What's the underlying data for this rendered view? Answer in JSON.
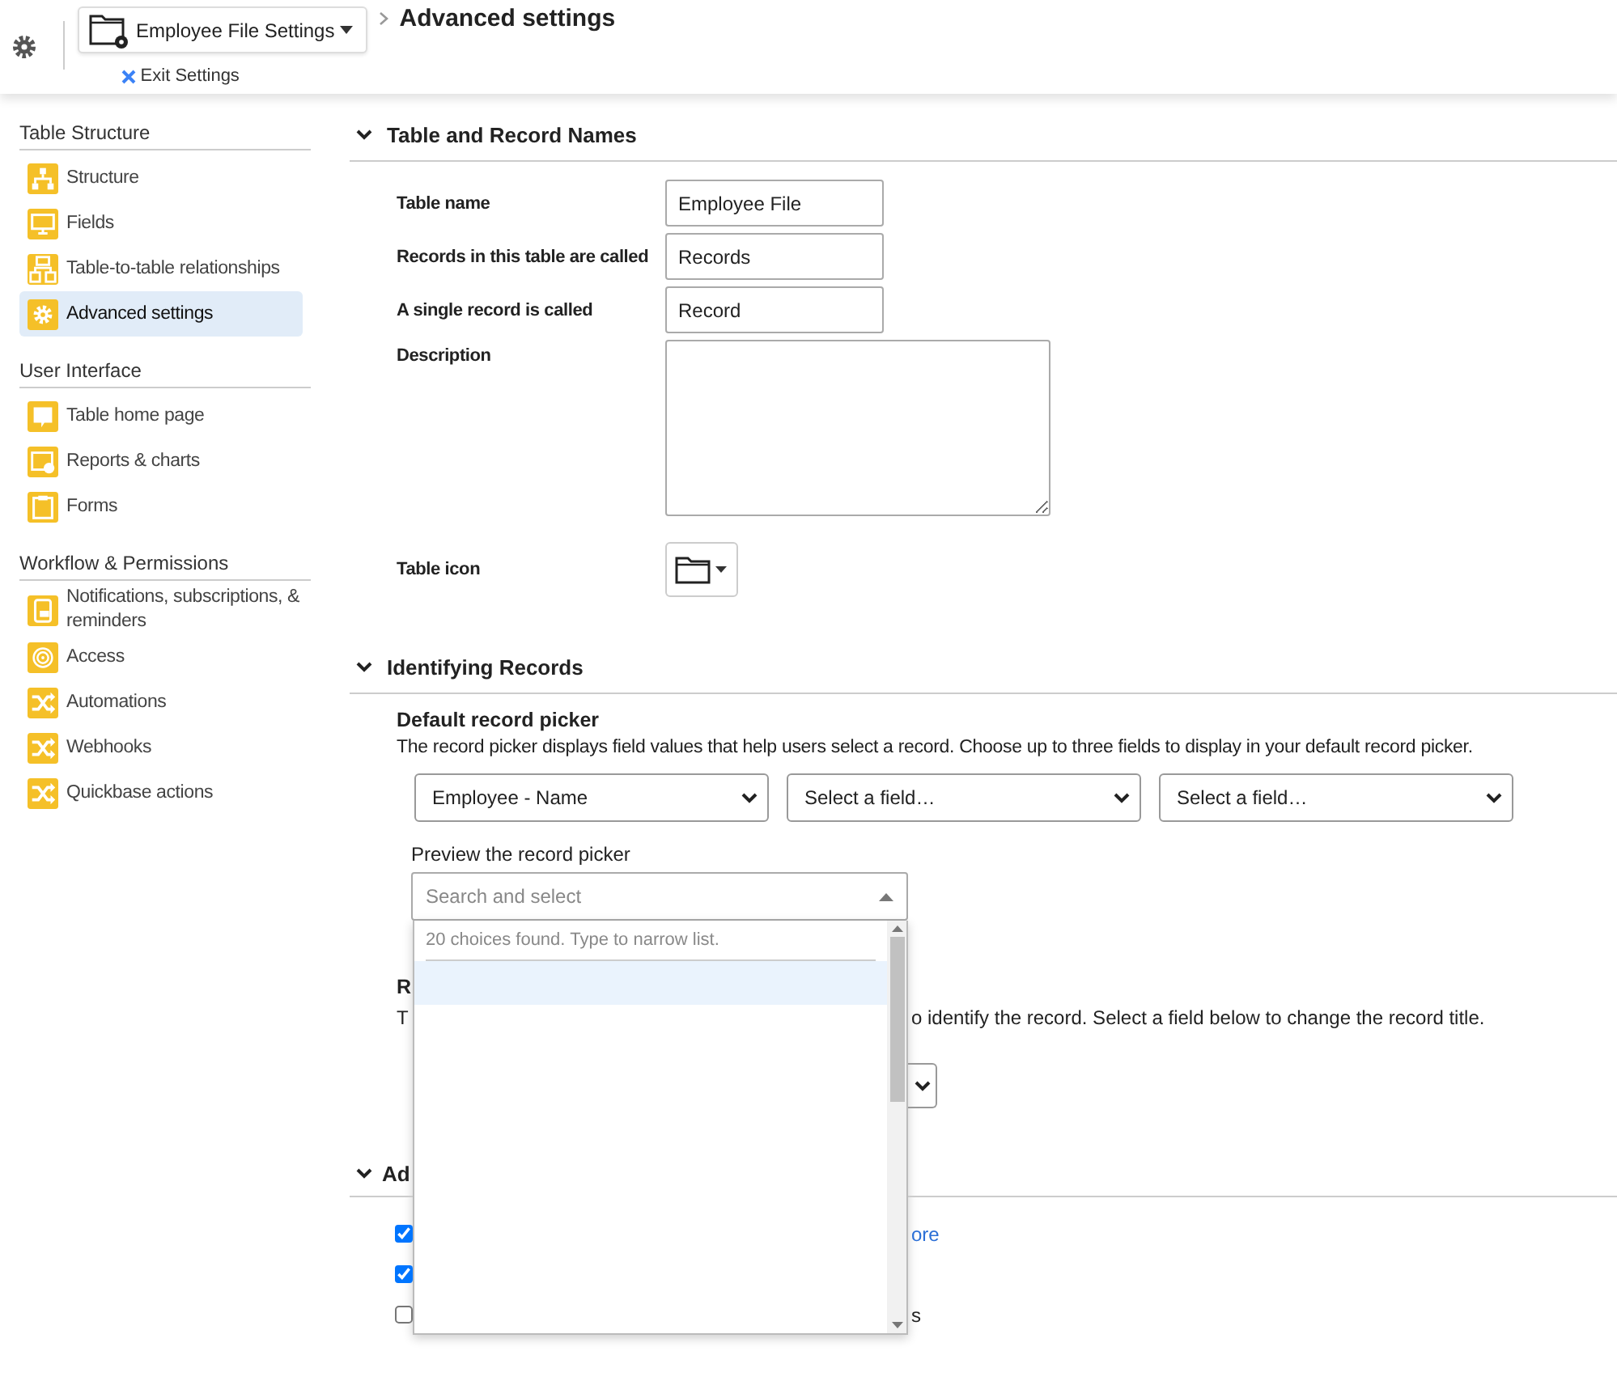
{
  "header": {
    "app_menu": "Employee File Settings",
    "exit": "Exit Settings",
    "page_title": "Advanced settings"
  },
  "sidebar": [
    {
      "title": "Table Structure",
      "items": [
        {
          "label": "Structure",
          "selected": false
        },
        {
          "label": "Fields",
          "selected": false
        },
        {
          "label": "Table-to-table relationships",
          "selected": false
        },
        {
          "label": "Advanced settings",
          "selected": true
        }
      ]
    },
    {
      "title": "User Interface",
      "items": [
        {
          "label": "Table home page",
          "selected": false
        },
        {
          "label": "Reports & charts",
          "selected": false
        },
        {
          "label": "Forms",
          "selected": false
        }
      ]
    },
    {
      "title": "Workflow & Permissions",
      "items": [
        {
          "label": "Notifications, subscriptions, & reminders",
          "selected": false
        },
        {
          "label": "Access",
          "selected": false
        },
        {
          "label": "Automations",
          "selected": false
        },
        {
          "label": "Webhooks",
          "selected": false
        },
        {
          "label": "Quickbase actions",
          "selected": false
        }
      ]
    }
  ],
  "names_section": {
    "title": "Table and Record Names",
    "fields": [
      {
        "label": "Table name",
        "value": "Employee File"
      },
      {
        "label": "Records in this table are called",
        "value": "Records"
      },
      {
        "label": "A single record is called",
        "value": "Record"
      }
    ],
    "description_label": "Description",
    "icon_label": "Table icon"
  },
  "identifying_section": {
    "title": "Identifying Records",
    "picker_heading": "Default record picker",
    "picker_description": "The record picker displays field values that help users select a record. Choose up to three fields to display in your default record picker.",
    "selects": [
      "Employee - Name",
      "Select a field…",
      "Select a field…"
    ],
    "preview_label": "Preview the record picker",
    "preview_placeholder": "Search and select",
    "dropdown_hint": "20 choices found. Type to narrow list.",
    "title_heading": "R",
    "title_description_start": "T",
    "title_description_end": "o identify the record. Select a field below to change the record title."
  },
  "advanced_section": {
    "title": "Ad",
    "options": [
      {
        "checked": true,
        "link": "ore"
      },
      {
        "checked": true
      },
      {
        "checked": false,
        "label": "s"
      }
    ]
  }
}
